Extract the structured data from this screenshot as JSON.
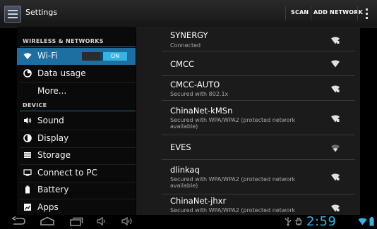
{
  "app": {
    "title": "Settings"
  },
  "actions": {
    "scan": "SCAN",
    "add_network": "ADD NETWORK"
  },
  "menu": {
    "wireless_header": "WIRELESS & NETWORKS",
    "wifi": {
      "label": "Wi-Fi",
      "toggle_on": "ON"
    },
    "data_usage": "Data usage",
    "more": "More...",
    "device_header": "DEVICE",
    "sound": "Sound",
    "display": "Display",
    "storage": "Storage",
    "connect_pc": "Connect to PC",
    "battery": "Battery",
    "apps": "Apps"
  },
  "networks": [
    {
      "name": "SYNERGY",
      "status": "Connected"
    },
    {
      "name": "CMCC",
      "status": ""
    },
    {
      "name": "CMCC-AUTO",
      "status": "Secured with 802.1x"
    },
    {
      "name": "ChinaNet-kMSn",
      "status": "Secured with WPA/WPA2 (protected network available)"
    },
    {
      "name": "EVES",
      "status": ""
    },
    {
      "name": "dlinkaq",
      "status": "Secured with WPA/WPA2 (protected network available)"
    },
    {
      "name": "ChinaNet-jhxr",
      "status": "Secured with WPA/WPA2 (protected network"
    }
  ],
  "status_bar": {
    "time": "2:59"
  },
  "colors": {
    "accent": "#33b5e5",
    "selected": "#1e6fa1"
  },
  "icons": [
    "wifi-icon",
    "data-usage-icon",
    "sound-icon",
    "display-icon",
    "storage-icon",
    "pc-icon",
    "battery-icon",
    "apps-icon",
    "back-icon",
    "home-icon",
    "recent-apps-icon",
    "volume-down-icon",
    "volume-up-icon",
    "usb-icon",
    "debug-icon",
    "wifi-signal-icon"
  ]
}
